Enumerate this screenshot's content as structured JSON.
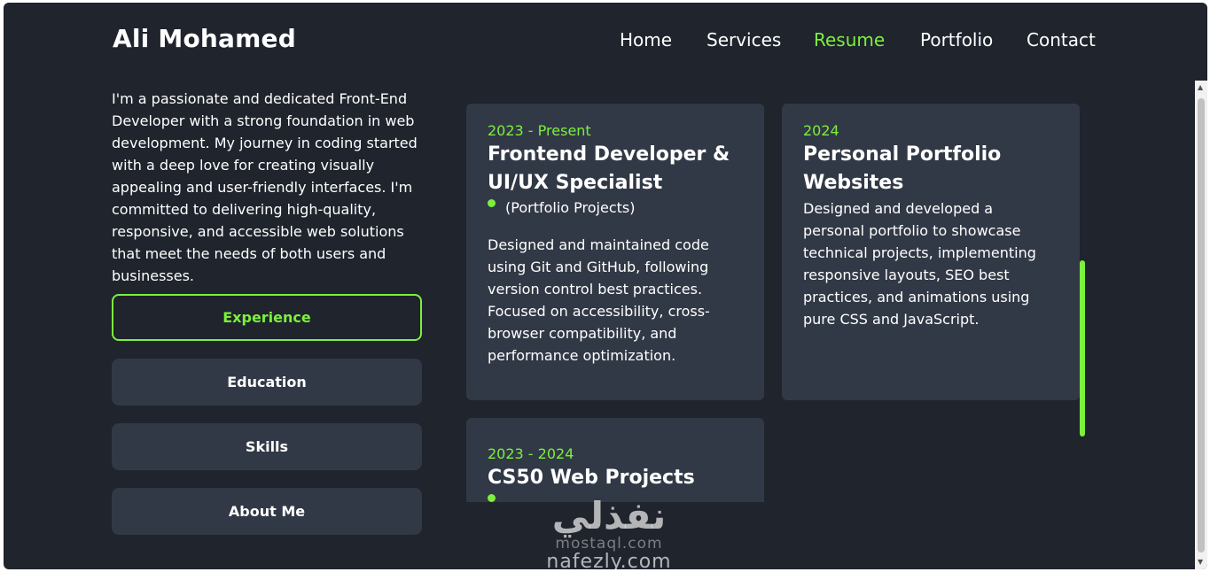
{
  "header": {
    "logo": "Ali Mohamed",
    "nav": [
      {
        "label": "Home",
        "active": false
      },
      {
        "label": "Services",
        "active": false
      },
      {
        "label": "Resume",
        "active": true
      },
      {
        "label": "Portfolio",
        "active": false
      },
      {
        "label": "Contact",
        "active": false
      }
    ]
  },
  "intro": "I'm a passionate and dedicated Front-End Developer with a strong foundation in web development. My journey in coding started with a deep love for creating visually appealing and user-friendly interfaces. I'm committed to delivering high-quality, responsive, and accessible web solutions that meet the needs of both users and businesses.",
  "tabs": [
    {
      "label": "Experience",
      "active": true
    },
    {
      "label": "Education",
      "active": false
    },
    {
      "label": "Skills",
      "active": false
    },
    {
      "label": "About Me",
      "active": false
    }
  ],
  "cards": [
    {
      "year": "2023 - Present",
      "title": "Frontend Developer & UI/UX Specialist",
      "subtitle": "(Portfolio Projects)",
      "description": "Designed and maintained code using Git and GitHub, following version control best practices. Focused on accessibility, cross-browser compatibility, and performance optimization."
    },
    {
      "year": "2024",
      "title": "Personal Portfolio Websites",
      "description": "Designed and developed a personal portfolio to showcase technical projects, implementing responsive layouts, SEO best practices, and animations using pure CSS and JavaScript."
    },
    {
      "year": "2023 - 2024",
      "title": "CS50 Web Projects"
    }
  ],
  "watermark": {
    "arabic": "نفذلي",
    "line1": "mostaql.com",
    "line2": "nafezly.com"
  },
  "colors": {
    "background": "#1f242d",
    "card": "#323946",
    "accent": "#7cf03d"
  }
}
